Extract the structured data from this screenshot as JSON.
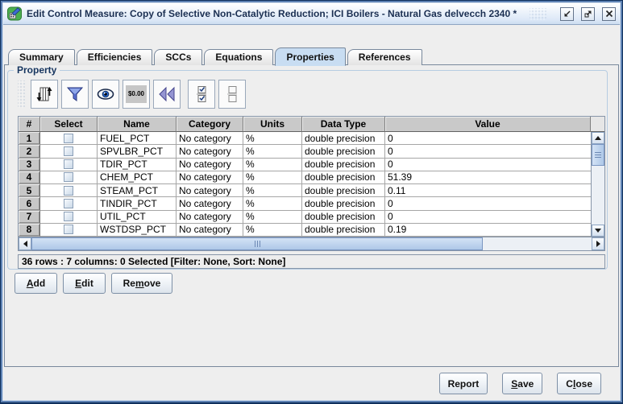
{
  "window": {
    "title": "Edit Control Measure: Copy of Selective Non-Catalytic Reduction; ICI Boilers - Natural Gas delvecch 2340 *",
    "controls": [
      "minimize",
      "maximize",
      "close"
    ]
  },
  "tabs": [
    {
      "label": "Summary",
      "selected": false
    },
    {
      "label": "Efficiencies",
      "selected": false
    },
    {
      "label": "SCCs",
      "selected": false
    },
    {
      "label": "Equations",
      "selected": false
    },
    {
      "label": "Properties",
      "selected": true
    },
    {
      "label": "References",
      "selected": false
    }
  ],
  "property_panel": {
    "title": "Property",
    "toolbar": {
      "buttons": [
        {
          "name": "sort",
          "icon": "sort-columns-icon"
        },
        {
          "name": "filter",
          "icon": "filter-rows-icon"
        },
        {
          "name": "show-hide-columns",
          "icon": "eye-icon"
        },
        {
          "name": "format-columns",
          "icon": "currency-format-icon",
          "label": "$0.00"
        },
        {
          "name": "reset",
          "icon": "rewind-icon"
        },
        {
          "name": "select-all",
          "icon": "select-all-icon"
        },
        {
          "name": "clear-all",
          "icon": "clear-all-icon"
        }
      ]
    },
    "table": {
      "columns": [
        "#",
        "Select",
        "Name",
        "Category",
        "Units",
        "Data Type",
        "Value"
      ],
      "rows": [
        {
          "num": "1",
          "name": "FUEL_PCT",
          "category": "No category",
          "units": "%",
          "data_type": "double precision",
          "value": "0"
        },
        {
          "num": "2",
          "name": "SPVLBR_PCT",
          "category": "No category",
          "units": "%",
          "data_type": "double precision",
          "value": "0"
        },
        {
          "num": "3",
          "name": "TDIR_PCT",
          "category": "No category",
          "units": "%",
          "data_type": "double precision",
          "value": "0"
        },
        {
          "num": "4",
          "name": "CHEM_PCT",
          "category": "No category",
          "units": "%",
          "data_type": "double precision",
          "value": "51.39"
        },
        {
          "num": "5",
          "name": "STEAM_PCT",
          "category": "No category",
          "units": "%",
          "data_type": "double precision",
          "value": "0.11"
        },
        {
          "num": "6",
          "name": "TINDIR_PCT",
          "category": "No category",
          "units": "%",
          "data_type": "double precision",
          "value": "0"
        },
        {
          "num": "7",
          "name": "UTIL_PCT",
          "category": "No category",
          "units": "%",
          "data_type": "double precision",
          "value": "0"
        },
        {
          "num": "8",
          "name": "WSTDSP_PCT",
          "category": "No category",
          "units": "%",
          "data_type": "double precision",
          "value": "0.19"
        }
      ]
    },
    "status": "36 rows : 7 columns: 0 Selected [Filter: None, Sort: None]"
  },
  "crud_buttons": {
    "add": {
      "label": "Add",
      "underline": 0
    },
    "edit": {
      "label": "Edit",
      "underline": 0
    },
    "remove": {
      "label": "Remove",
      "underline": 2
    }
  },
  "footer_buttons": {
    "report": {
      "label": "Report",
      "underline": -1
    },
    "save": {
      "label": "Save",
      "underline": 0
    },
    "close": {
      "label": "Close",
      "underline": 1
    }
  },
  "colors": {
    "frame_dark": "#10305C",
    "frame_mid": "#5E82B4",
    "titlebar_text": "#1B2F52",
    "tab_selected_bg": "#C8DDF2",
    "header_bg": "#C9C9C9",
    "scroll_thumb": "#AEC8E8",
    "panel_bg": "#EEEEEE"
  }
}
